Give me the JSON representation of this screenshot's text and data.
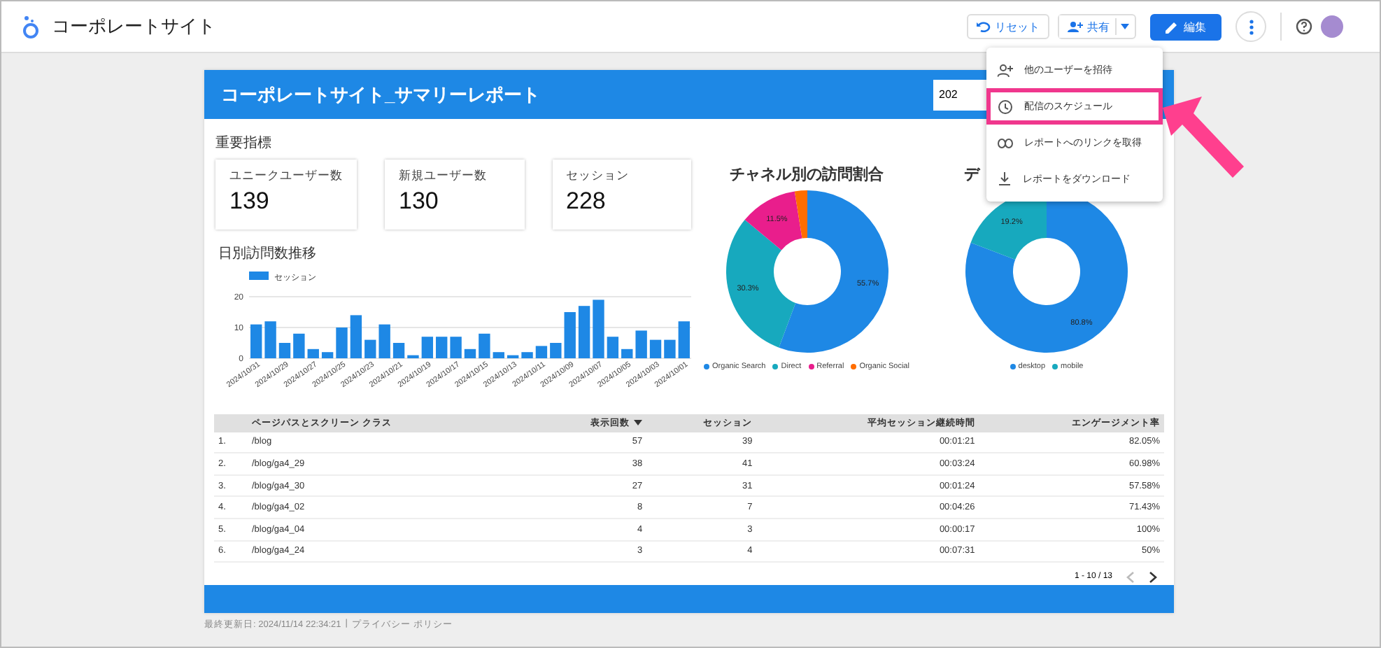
{
  "app": {
    "title": "コーポレートサイト"
  },
  "toolbar": {
    "reset": "リセット",
    "share": "共有",
    "edit": "編集"
  },
  "report": {
    "title": "コーポレートサイト_サマリーレポート",
    "date_range": "202",
    "kpi_heading": "重要指標",
    "kpis": [
      {
        "label": "ユニークユーザー数",
        "value": "139"
      },
      {
        "label": "新規ユーザー数",
        "value": "130"
      },
      {
        "label": "セッション",
        "value": "228"
      }
    ],
    "daily_chart": {
      "title": "日別訪問数推移",
      "chart_data": {
        "type": "bar",
        "legend": "top",
        "series": [
          {
            "name": "セッション",
            "color": "#1e88e5",
            "values": [
              11,
              12,
              5,
              8,
              3,
              2,
              10,
              14,
              6,
              11,
              5,
              1,
              7,
              7,
              7,
              3,
              8,
              2,
              1,
              2,
              4,
              5,
              15,
              17,
              19,
              7,
              3,
              9,
              6,
              6,
              12
            ]
          }
        ],
        "categories": [
          "2024/10/31",
          null,
          "2024/10/29",
          null,
          "2024/10/27",
          null,
          "2024/10/25",
          null,
          "2024/10/23",
          null,
          "2024/10/21",
          null,
          "2024/10/19",
          null,
          "2024/10/17",
          null,
          "2024/10/15",
          null,
          "2024/10/13",
          null,
          "2024/10/11",
          null,
          "2024/10/09",
          null,
          "2024/10/07",
          null,
          "2024/10/05",
          null,
          "2024/10/03",
          null,
          "2024/10/01"
        ],
        "ylim": [
          0,
          20
        ],
        "yticks": [
          0,
          10,
          20
        ]
      }
    },
    "channel_chart": {
      "title": "チャネル別の訪問割合",
      "chart_data": {
        "type": "donut",
        "legend": "bottom",
        "categories": [
          "Organic Search",
          "Direct",
          "Referral",
          "Organic Social"
        ],
        "values": [
          55.7,
          30.3,
          11.5,
          2.5
        ],
        "value_labels": [
          "55.7%",
          "30.3%",
          "11.5%",
          null
        ]
      }
    },
    "device_chart": {
      "title": "デ",
      "chart_data": {
        "type": "donut",
        "legend": "bottom",
        "categories": [
          "desktop",
          "mobile"
        ],
        "values": [
          80.8,
          19.2
        ],
        "value_labels": [
          "80.8%",
          "19.2%"
        ]
      }
    },
    "table": {
      "columns": [
        {
          "sorted": false
        },
        {
          "label": "ページパスとスクリーン クラス",
          "sorted": false
        },
        {
          "label": "表示回数",
          "sorted": true
        },
        {
          "label": "セッション",
          "sorted": false
        },
        {
          "label": "平均セッション継続時間",
          "sorted": false
        },
        {
          "label": "エンゲージメント率",
          "sorted": false
        }
      ],
      "rows": [
        [
          "1.",
          "/blog",
          "57",
          "39",
          "00:01:21",
          "82.05%"
        ],
        [
          "2.",
          "/blog/ga4_29",
          "38",
          "41",
          "00:03:24",
          "60.98%"
        ],
        [
          "3.",
          "/blog/ga4_30",
          "27",
          "31",
          "00:01:24",
          "57.58%"
        ],
        [
          "4.",
          "/blog/ga4_02",
          "8",
          "7",
          "00:04:26",
          "71.43%"
        ],
        [
          "5.",
          "/blog/ga4_04",
          "4",
          "3",
          "00:00:17",
          "100%"
        ],
        [
          "6.",
          "/blog/ga4_24",
          "3",
          "4",
          "00:07:31",
          "50%"
        ]
      ],
      "pagination": "1 - 10 / 13"
    }
  },
  "footer": {
    "updated": "最終更新日: 2024/11/14 22:34:21",
    "separator": "|",
    "privacy": "プライバシー ポリシー"
  },
  "share_menu": {
    "items": [
      {
        "label": "他のユーザーを招待",
        "selected": false
      },
      {
        "label": "配信のスケジュール",
        "selected": true
      },
      {
        "label": "レポートへのリンクを取得",
        "selected": false
      },
      {
        "label": "レポートをダウンロード",
        "selected": false
      }
    ]
  }
}
